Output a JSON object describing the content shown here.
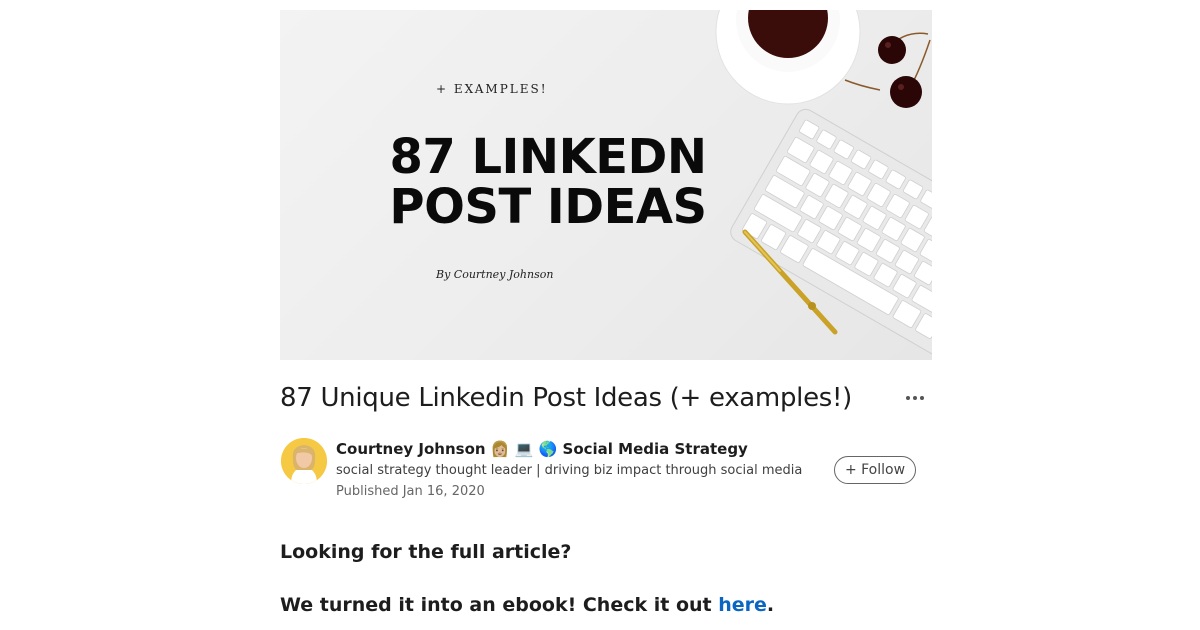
{
  "hero": {
    "kicker": "+ EXAMPLES!",
    "title_line1": "87 LINKEDN",
    "title_line2": "POST IDEAS",
    "byline": "By Courtney Johnson"
  },
  "article": {
    "title": "87 Unique Linkedin Post Ideas (+ examples!)",
    "more_icon": "more-horizontal-icon"
  },
  "author": {
    "name": "Courtney Johnson",
    "emojis": "👩🏼 💻 🌎",
    "topic": "Social Media Strategy",
    "headline": "social strategy thought leader | driving biz impact through social media",
    "published": "Published Jan 16, 2020",
    "follow_label": "+ Follow"
  },
  "body": {
    "line1": "Looking for the full article?",
    "line2_prefix": "We turned it into an ebook! Check it out ",
    "line2_link": "here",
    "line2_suffix": "."
  },
  "colors": {
    "link": "#0a66c2",
    "avatar_bg": "#f6c945"
  }
}
